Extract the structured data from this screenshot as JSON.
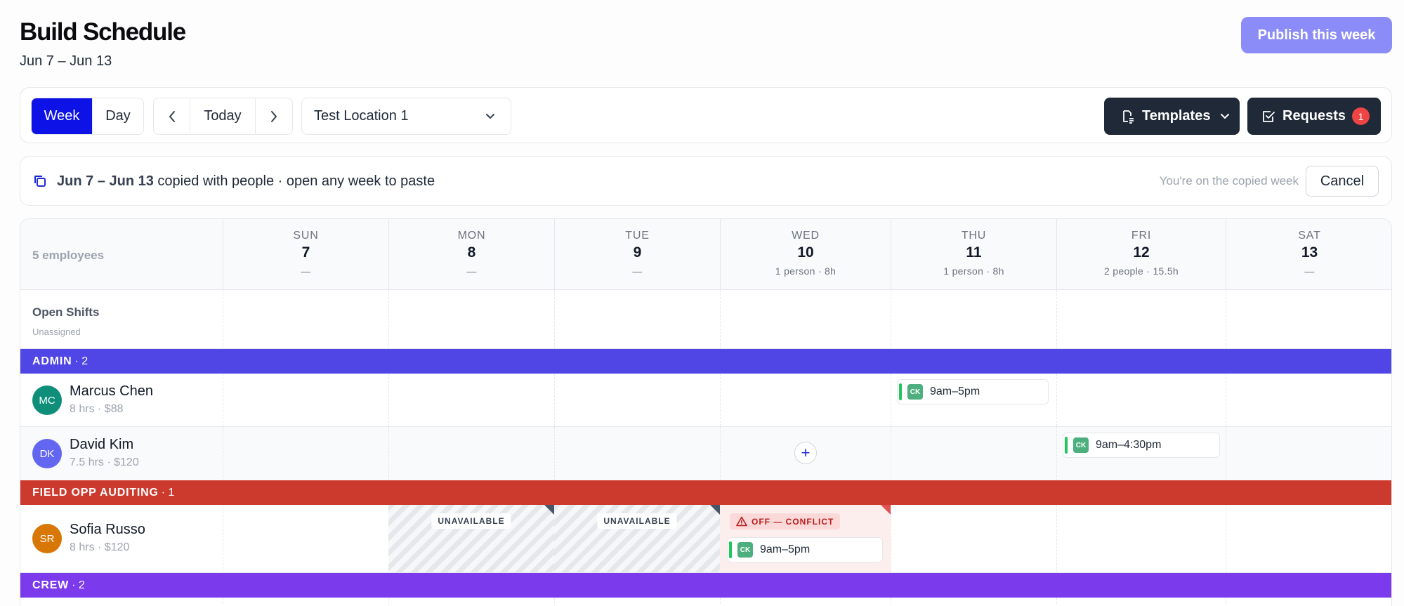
{
  "header": {
    "title": "Build Schedule",
    "date_range": "Jun 7 – Jun 13",
    "publish_label": "Publish this week"
  },
  "toolbar": {
    "view_week": "Week",
    "view_day": "Day",
    "today_label": "Today",
    "location": "Test Location 1",
    "templates_label": "Templates",
    "requests_label": "Requests",
    "requests_count": "1"
  },
  "copy_notice": {
    "range": "Jun 7 – Jun 13",
    "message": " copied with people · open any week to paste",
    "hint": "You're on the copied week",
    "cancel_label": "Cancel"
  },
  "schedule": {
    "employee_count": "5 employees",
    "days": [
      {
        "name": "SUN",
        "num": "7",
        "summary": "—"
      },
      {
        "name": "MON",
        "num": "8",
        "summary": "—"
      },
      {
        "name": "TUE",
        "num": "9",
        "summary": "—"
      },
      {
        "name": "WED",
        "num": "10",
        "summary": "1 person · 8h"
      },
      {
        "name": "THU",
        "num": "11",
        "summary": "1 person · 8h"
      },
      {
        "name": "FRI",
        "num": "12",
        "summary": "2 people · 15.5h"
      },
      {
        "name": "SAT",
        "num": "13",
        "summary": "—"
      }
    ],
    "open_shifts": {
      "title": "Open Shifts",
      "subtitle": "Unassigned"
    },
    "groups": [
      {
        "name": "ADMIN",
        "count": "· 2",
        "color": "#4f46e5"
      },
      {
        "name": "FIELD OPP AUDITING",
        "count": "· 1",
        "color": "#cc3a2e"
      },
      {
        "name": "CREW",
        "count": "· 2",
        "color": "#7c3aed"
      }
    ],
    "employees": [
      {
        "initials": "MC",
        "name": "Marcus Chen",
        "meta": "8 hrs · $88",
        "avatar_color": "#0f8f7a"
      },
      {
        "initials": "DK",
        "name": "David Kim",
        "meta": "7.5 hrs · $120",
        "avatar_color": "#6366f1"
      },
      {
        "initials": "SR",
        "name": "Sofia Russo",
        "meta": "8 hrs · $120",
        "avatar_color": "#d97706"
      }
    ],
    "shifts": {
      "marcus_thu": {
        "badge": "CK",
        "time": "9am–5pm"
      },
      "david_fri": {
        "badge": "CK",
        "time": "9am–4:30pm"
      },
      "sofia_wed": {
        "badge": "CK",
        "time": "9am–5pm"
      }
    },
    "unavailable_label": "UNAVAILABLE",
    "conflict_label": "OFF — CONFLICT",
    "add_shift_symbol": "+"
  }
}
